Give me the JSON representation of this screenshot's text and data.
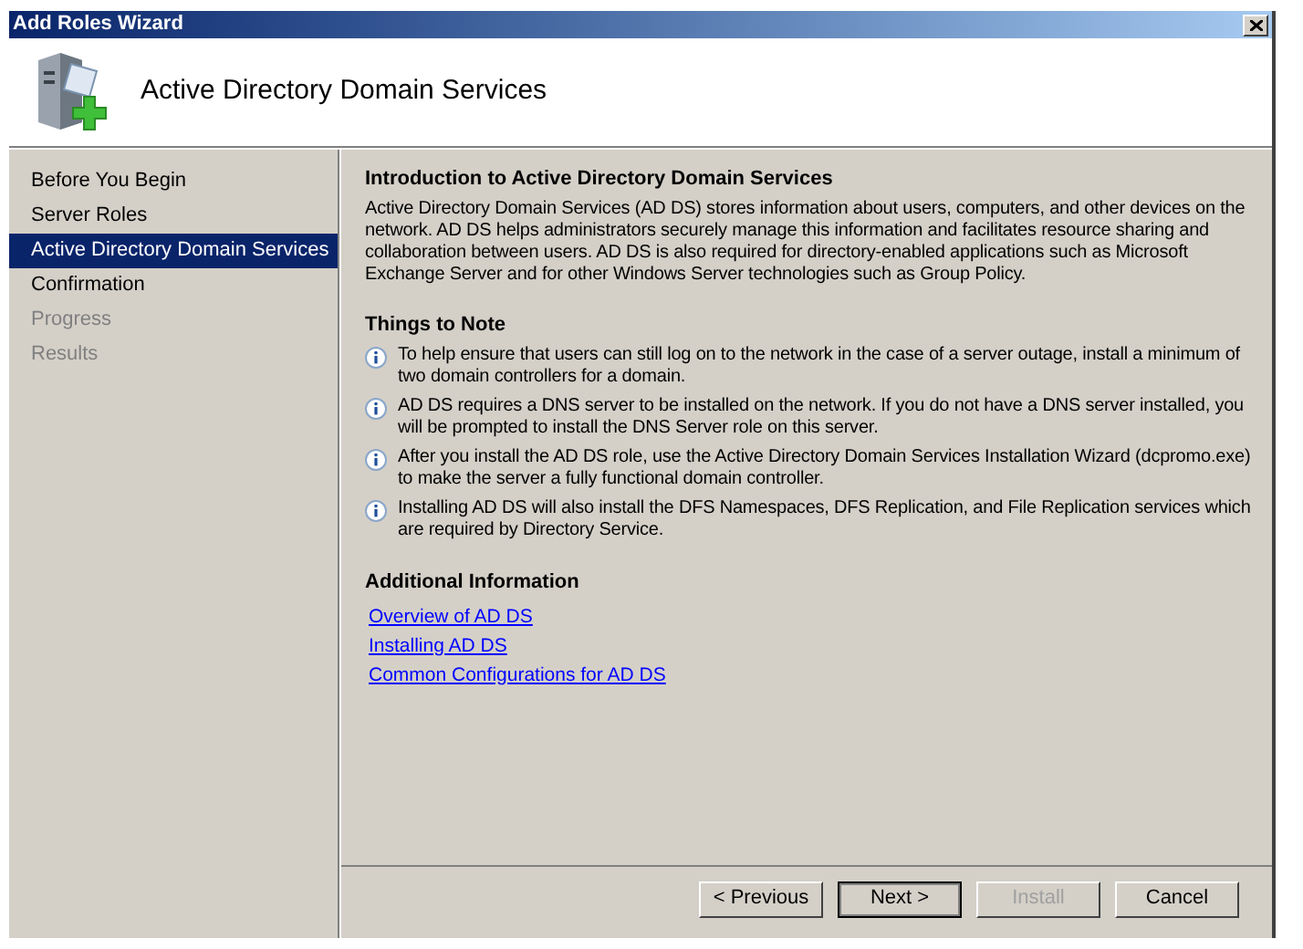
{
  "window": {
    "title": "Add Roles Wizard"
  },
  "header": {
    "title": "Active Directory Domain Services"
  },
  "sidebar": {
    "items": [
      {
        "label": "Before You Begin",
        "selected": false,
        "disabled": false
      },
      {
        "label": "Server Roles",
        "selected": false,
        "disabled": false
      },
      {
        "label": "Active Directory Domain Services",
        "selected": true,
        "disabled": false
      },
      {
        "label": "Confirmation",
        "selected": false,
        "disabled": false
      },
      {
        "label": "Progress",
        "selected": false,
        "disabled": true
      },
      {
        "label": "Results",
        "selected": false,
        "disabled": true
      }
    ]
  },
  "content": {
    "intro_heading": "Introduction to Active Directory Domain Services",
    "intro_text": "Active Directory Domain Services (AD DS) stores information about users, computers, and other devices on the network. AD DS helps administrators securely manage this information and facilitates resource sharing and collaboration between users. AD DS is also required for directory-enabled applications such as Microsoft Exchange Server and for other Windows Server technologies such as Group Policy.",
    "notes_heading": "Things to Note",
    "notes": [
      "To help ensure that users can still log on to the network in the case of a server outage, install a minimum of two domain controllers for a domain.",
      "AD DS requires a DNS server to be installed on the network. If you do not have a DNS server installed, you will be prompted to install the DNS Server role on this server.",
      "After you install the AD DS role, use the Active Directory Domain Services Installation Wizard (dcpromo.exe) to make the server a fully functional domain controller.",
      "Installing AD DS will also install the DFS Namespaces, DFS Replication, and File Replication services which are required by Directory Service."
    ],
    "info_heading": "Additional Information",
    "links": [
      "Overview of AD DS",
      "Installing AD DS",
      "Common Configurations for AD DS"
    ]
  },
  "buttons": [
    {
      "label": "< Previous",
      "disabled": false,
      "default": false
    },
    {
      "label": "Next >",
      "disabled": false,
      "default": true
    },
    {
      "label": "Install",
      "disabled": true,
      "default": false
    },
    {
      "label": "Cancel",
      "disabled": false,
      "default": false
    }
  ]
}
